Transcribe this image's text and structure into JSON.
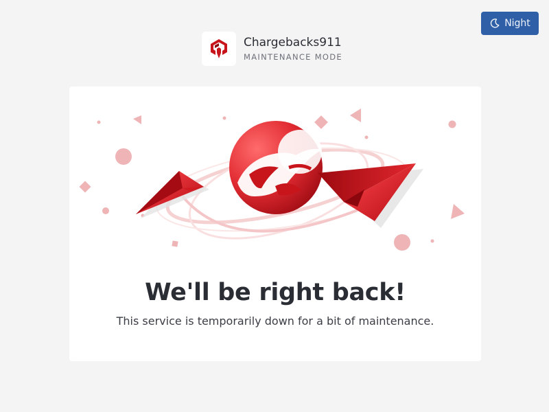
{
  "theme_toggle": {
    "label": "Night",
    "icon": "moon-icon"
  },
  "brand": {
    "name": "Chargebacks911",
    "mode": "MAINTENANCE MODE",
    "logo_color": "#c8141b"
  },
  "message": {
    "headline": "We'll be right back!",
    "subtext": "This service is temporarily down for a bit of maintenance."
  },
  "colors": {
    "page_bg": "#f4f4f5",
    "button_bg": "#2f5fa6",
    "accent_red": "#d42a2f",
    "decor_pink": "#eeb4b6"
  }
}
